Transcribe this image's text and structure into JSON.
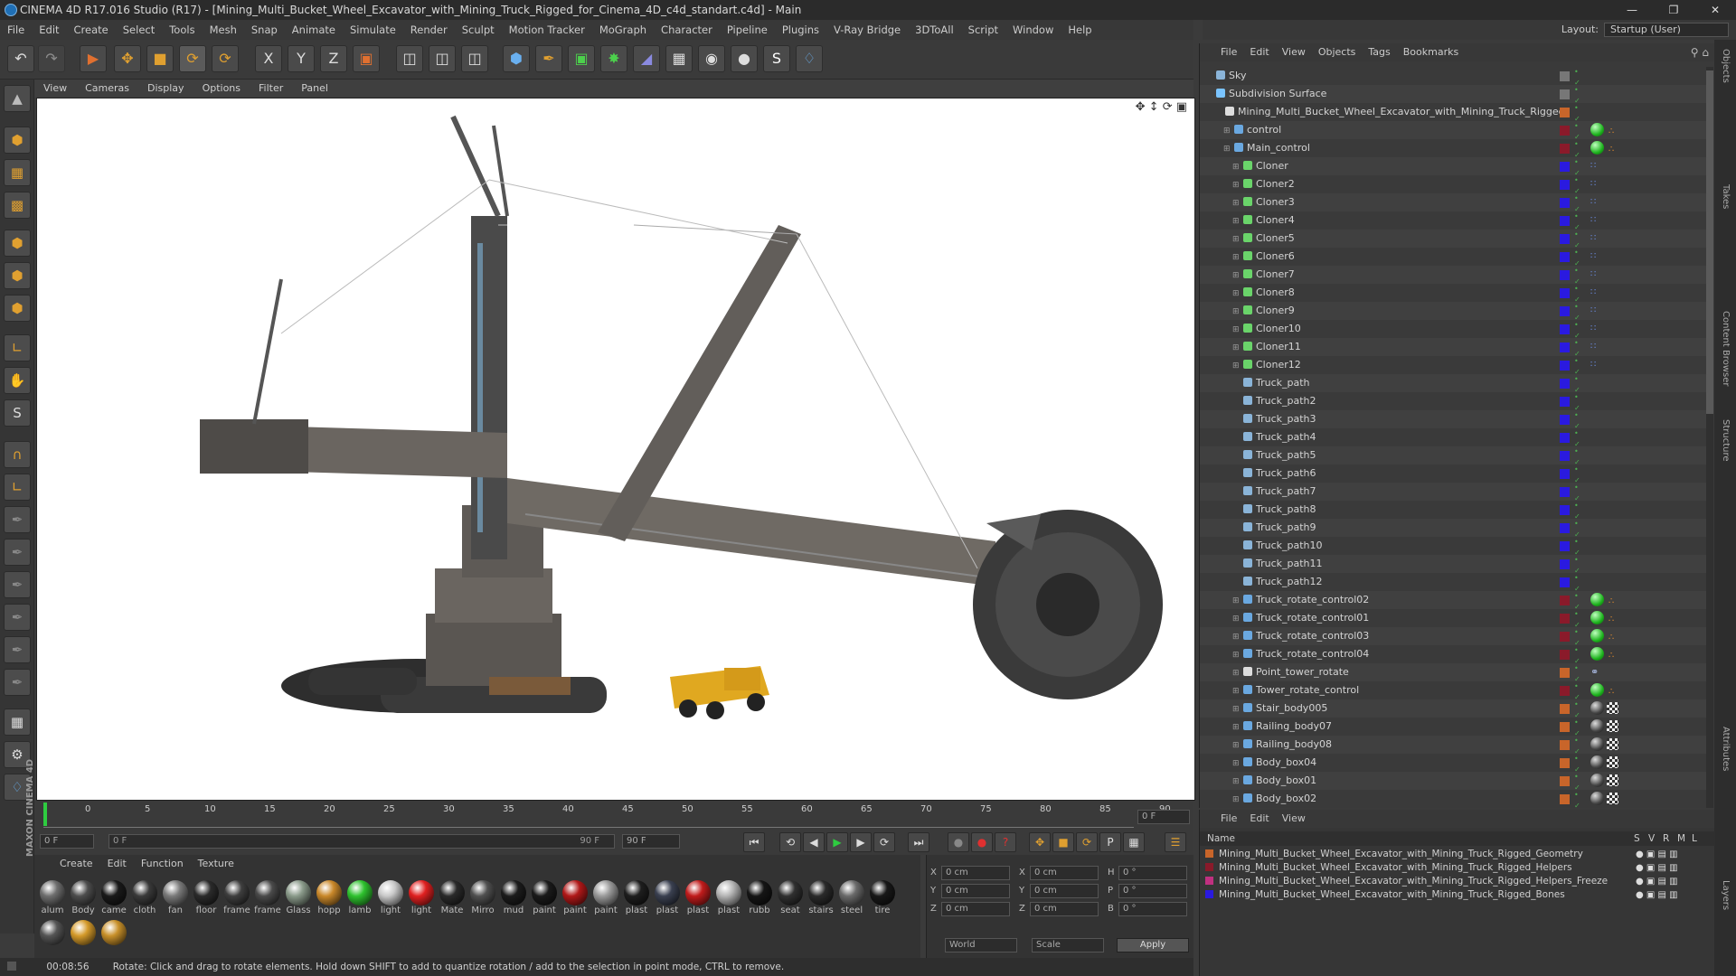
{
  "window": {
    "title": "CINEMA 4D R17.016 Studio (R17) - [Mining_Multi_Bucket_Wheel_Excavator_with_Mining_Truck_Rigged_for_Cinema_4D_c4d_standart.c4d] - Main"
  },
  "menu": [
    "File",
    "Edit",
    "Create",
    "Select",
    "Tools",
    "Mesh",
    "Snap",
    "Animate",
    "Simulate",
    "Render",
    "Sculpt",
    "Motion Tracker",
    "MoGraph",
    "Character",
    "Pipeline",
    "Plugins",
    "V-Ray Bridge",
    "3DToAll",
    "Script",
    "Window",
    "Help"
  ],
  "layout": {
    "label": "Layout:",
    "value": "Startup (User)"
  },
  "viewport_menu": [
    "View",
    "Cameras",
    "Display",
    "Options",
    "Filter",
    "Panel"
  ],
  "timeline": {
    "ticks": [
      "0",
      "5",
      "10",
      "15",
      "20",
      "25",
      "30",
      "35",
      "40",
      "45",
      "50",
      "55",
      "60",
      "65",
      "70",
      "75",
      "80",
      "85",
      "90"
    ],
    "frame_display": "0 F",
    "start": "0 F",
    "range_start": "0 F",
    "range_end": "90 F",
    "end": "90 F"
  },
  "materials": {
    "menu": [
      "Create",
      "Edit",
      "Function",
      "Texture"
    ],
    "items": [
      {
        "label": "alum",
        "color": "#6e6e6e"
      },
      {
        "label": "Body",
        "color": "#4d4d4d"
      },
      {
        "label": "came",
        "color": "#1a1a1a"
      },
      {
        "label": "cloth",
        "color": "#3a3a3a"
      },
      {
        "label": "fan",
        "color": "#7a7a7a"
      },
      {
        "label": "floor",
        "color": "#2b2b2b"
      },
      {
        "label": "frame",
        "color": "#3e3e3e"
      },
      {
        "label": "frame",
        "color": "#4a4a4a"
      },
      {
        "label": "Glass",
        "color": "#8a9a8a"
      },
      {
        "label": "hopp",
        "color": "#c9882a"
      },
      {
        "label": "lamb",
        "color": "#2ec22e"
      },
      {
        "label": "light",
        "color": "#c8c8c8"
      },
      {
        "label": "light",
        "color": "#e02020"
      },
      {
        "label": "Mate",
        "color": "#2a2a2a"
      },
      {
        "label": "Mirro",
        "color": "#505050"
      },
      {
        "label": "mud",
        "color": "#1c1c1c"
      },
      {
        "label": "paint",
        "color": "#1a1a1a"
      },
      {
        "label": "paint",
        "color": "#b01818"
      },
      {
        "label": "paint",
        "color": "#9a9a9a"
      },
      {
        "label": "plast",
        "color": "#1e1e1e"
      },
      {
        "label": "plast",
        "color": "#3a4050"
      },
      {
        "label": "plast",
        "color": "#c01c1c"
      },
      {
        "label": "plast",
        "color": "#b4b4b4"
      },
      {
        "label": "rubb",
        "color": "#151515"
      },
      {
        "label": "seat",
        "color": "#303030"
      },
      {
        "label": "stairs",
        "color": "#2a2a2a"
      },
      {
        "label": "steel",
        "color": "#6a6a6a"
      },
      {
        "label": "tire",
        "color": "#181818"
      },
      {
        "label": "",
        "color": "#555555"
      },
      {
        "label": "",
        "color": "#d49a2a"
      },
      {
        "label": "",
        "color": "#c8902a"
      }
    ]
  },
  "coords": {
    "rows": [
      {
        "a": "X",
        "av": "0 cm",
        "b": "X",
        "bv": "0 cm",
        "c": "H",
        "cv": "0 °"
      },
      {
        "a": "Y",
        "av": "0 cm",
        "b": "Y",
        "bv": "0 cm",
        "c": "P",
        "cv": "0 °"
      },
      {
        "a": "Z",
        "av": "0 cm",
        "b": "Z",
        "bv": "0 cm",
        "c": "B",
        "cv": "0 °"
      }
    ],
    "mode": "World",
    "scale": "Scale",
    "apply": "Apply"
  },
  "status": {
    "time": "00:08:56",
    "message": "Rotate: Click and drag to rotate elements. Hold down SHIFT to add to quantize rotation / add to the selection in point mode, CTRL to remove."
  },
  "objects": {
    "menu": [
      "File",
      "Edit",
      "View",
      "Objects",
      "Tags",
      "Bookmarks"
    ],
    "rows": [
      {
        "name": "Sky",
        "indent": 0,
        "icon": "#8ab4d8",
        "strip": "#777777",
        "tag": ""
      },
      {
        "name": "Subdivision Surface",
        "indent": 0,
        "icon": "#7ac4ff",
        "strip": "#777777",
        "tag": ""
      },
      {
        "name": "Mining_Multi_Bucket_Wheel_Excavator_with_Mining_Truck_Rigged",
        "indent": 1,
        "icon": "#dddddd",
        "strip": "#c8652a",
        "tag": ""
      },
      {
        "name": "control",
        "indent": 2,
        "icon": "#6aa8e0",
        "strip": "#8a1a2a",
        "tag": "green"
      },
      {
        "name": "Main_control",
        "indent": 2,
        "icon": "#6aa8e0",
        "strip": "#8a1a2a",
        "tag": "green"
      },
      {
        "name": "Cloner",
        "indent": 3,
        "icon": "#6ad46a",
        "strip": "#2a1ae0",
        "tag": "dots"
      },
      {
        "name": "Cloner2",
        "indent": 3,
        "icon": "#6ad46a",
        "strip": "#2a1ae0",
        "tag": "dots"
      },
      {
        "name": "Cloner3",
        "indent": 3,
        "icon": "#6ad46a",
        "strip": "#2a1ae0",
        "tag": "dots"
      },
      {
        "name": "Cloner4",
        "indent": 3,
        "icon": "#6ad46a",
        "strip": "#2a1ae0",
        "tag": "dots"
      },
      {
        "name": "Cloner5",
        "indent": 3,
        "icon": "#6ad46a",
        "strip": "#2a1ae0",
        "tag": "dots"
      },
      {
        "name": "Cloner6",
        "indent": 3,
        "icon": "#6ad46a",
        "strip": "#2a1ae0",
        "tag": "dots"
      },
      {
        "name": "Cloner7",
        "indent": 3,
        "icon": "#6ad46a",
        "strip": "#2a1ae0",
        "tag": "dots"
      },
      {
        "name": "Cloner8",
        "indent": 3,
        "icon": "#6ad46a",
        "strip": "#2a1ae0",
        "tag": "dots"
      },
      {
        "name": "Cloner9",
        "indent": 3,
        "icon": "#6ad46a",
        "strip": "#2a1ae0",
        "tag": "dots"
      },
      {
        "name": "Cloner10",
        "indent": 3,
        "icon": "#6ad46a",
        "strip": "#2a1ae0",
        "tag": "dots"
      },
      {
        "name": "Cloner11",
        "indent": 3,
        "icon": "#6ad46a",
        "strip": "#2a1ae0",
        "tag": "dots"
      },
      {
        "name": "Cloner12",
        "indent": 3,
        "icon": "#6ad46a",
        "strip": "#2a1ae0",
        "tag": "dots"
      },
      {
        "name": "Truck_path",
        "indent": 3,
        "icon": "#8ab4d8",
        "strip": "#2a1ae0",
        "tag": ""
      },
      {
        "name": "Truck_path2",
        "indent": 3,
        "icon": "#8ab4d8",
        "strip": "#2a1ae0",
        "tag": ""
      },
      {
        "name": "Truck_path3",
        "indent": 3,
        "icon": "#8ab4d8",
        "strip": "#2a1ae0",
        "tag": ""
      },
      {
        "name": "Truck_path4",
        "indent": 3,
        "icon": "#8ab4d8",
        "strip": "#2a1ae0",
        "tag": ""
      },
      {
        "name": "Truck_path5",
        "indent": 3,
        "icon": "#8ab4d8",
        "strip": "#2a1ae0",
        "tag": ""
      },
      {
        "name": "Truck_path6",
        "indent": 3,
        "icon": "#8ab4d8",
        "strip": "#2a1ae0",
        "tag": ""
      },
      {
        "name": "Truck_path7",
        "indent": 3,
        "icon": "#8ab4d8",
        "strip": "#2a1ae0",
        "tag": ""
      },
      {
        "name": "Truck_path8",
        "indent": 3,
        "icon": "#8ab4d8",
        "strip": "#2a1ae0",
        "tag": ""
      },
      {
        "name": "Truck_path9",
        "indent": 3,
        "icon": "#8ab4d8",
        "strip": "#2a1ae0",
        "tag": ""
      },
      {
        "name": "Truck_path10",
        "indent": 3,
        "icon": "#8ab4d8",
        "strip": "#2a1ae0",
        "tag": ""
      },
      {
        "name": "Truck_path11",
        "indent": 3,
        "icon": "#8ab4d8",
        "strip": "#2a1ae0",
        "tag": ""
      },
      {
        "name": "Truck_path12",
        "indent": 3,
        "icon": "#8ab4d8",
        "strip": "#2a1ae0",
        "tag": ""
      },
      {
        "name": "Truck_rotate_control02",
        "indent": 3,
        "icon": "#6aa8e0",
        "strip": "#8a1a2a",
        "tag": "green"
      },
      {
        "name": "Truck_rotate_control01",
        "indent": 3,
        "icon": "#6aa8e0",
        "strip": "#8a1a2a",
        "tag": "green"
      },
      {
        "name": "Truck_rotate_control03",
        "indent": 3,
        "icon": "#6aa8e0",
        "strip": "#8a1a2a",
        "tag": "green"
      },
      {
        "name": "Truck_rotate_control04",
        "indent": 3,
        "icon": "#6aa8e0",
        "strip": "#8a1a2a",
        "tag": "green"
      },
      {
        "name": "Point_tower_rotate",
        "indent": 3,
        "icon": "#dddddd",
        "strip": "#c8652a",
        "tag": "link"
      },
      {
        "name": "Tower_rotate_control",
        "indent": 3,
        "icon": "#6aa8e0",
        "strip": "#8a1a2a",
        "tag": "green"
      },
      {
        "name": "Stair_body005",
        "indent": 3,
        "icon": "#6aa8e0",
        "strip": "#c8652a",
        "tag": "mat"
      },
      {
        "name": "Railing_body07",
        "indent": 3,
        "icon": "#6aa8e0",
        "strip": "#c8652a",
        "tag": "mat"
      },
      {
        "name": "Railing_body08",
        "indent": 3,
        "icon": "#6aa8e0",
        "strip": "#c8652a",
        "tag": "mat"
      },
      {
        "name": "Body_box04",
        "indent": 3,
        "icon": "#6aa8e0",
        "strip": "#c8652a",
        "tag": "mat"
      },
      {
        "name": "Body_box01",
        "indent": 3,
        "icon": "#6aa8e0",
        "strip": "#c8652a",
        "tag": "mat"
      },
      {
        "name": "Body_box02",
        "indent": 3,
        "icon": "#6aa8e0",
        "strip": "#c8652a",
        "tag": "mat"
      }
    ]
  },
  "layers": {
    "menu": [
      "File",
      "Edit",
      "View"
    ],
    "header": {
      "name": "Name",
      "cols": [
        "S",
        "V",
        "R",
        "M",
        "L"
      ]
    },
    "rows": [
      {
        "name": "Mining_Multi_Bucket_Wheel_Excavator_with_Mining_Truck_Rigged_Geometry",
        "color": "#c8652a"
      },
      {
        "name": "Mining_Multi_Bucket_Wheel_Excavator_with_Mining_Truck_Rigged_Helpers",
        "color": "#8a1a2a"
      },
      {
        "name": "Mining_Multi_Bucket_Wheel_Excavator_with_Mining_Truck_Rigged_Helpers_Freeze",
        "color": "#c03080"
      },
      {
        "name": "Mining_Multi_Bucket_Wheel_Excavator_with_Mining_Truck_Rigged_Bones",
        "color": "#2a1ae0"
      }
    ]
  },
  "side_tabs": [
    "Objects",
    "Takes",
    "Content Browser",
    "Structure",
    "Attributes",
    "Layers"
  ],
  "brand": "MAXON CINEMA 4D"
}
